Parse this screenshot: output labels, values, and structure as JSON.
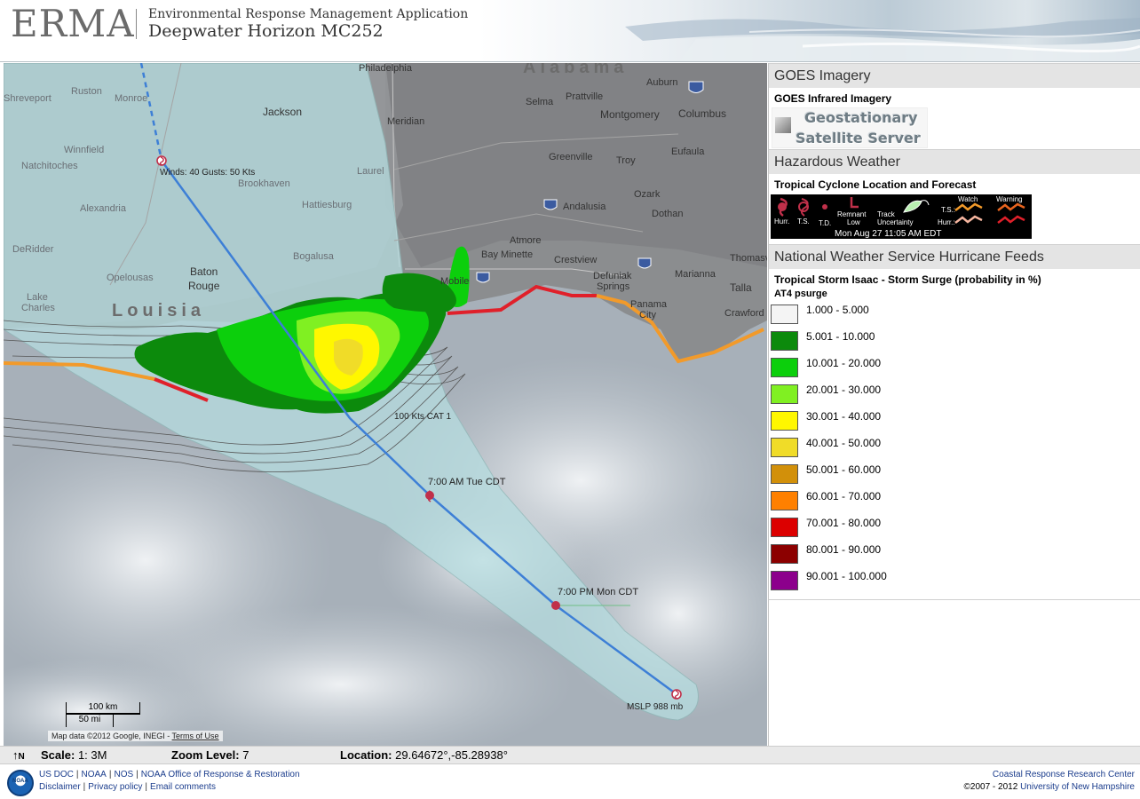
{
  "header": {
    "logo": "ERMA",
    "app_name": "Environmental Response Management Application",
    "app_subtitle": "Deepwater Horizon MC252"
  },
  "map": {
    "places": [
      {
        "name": "Shreveport"
      },
      {
        "name": "Ruston"
      },
      {
        "name": "Monroe"
      },
      {
        "name": "Jackson"
      },
      {
        "name": "Meridian"
      },
      {
        "name": "Philadelphia"
      },
      {
        "name": "Alabama"
      },
      {
        "name": "Selma"
      },
      {
        "name": "Prattville"
      },
      {
        "name": "Auburn"
      },
      {
        "name": "Montgomery"
      },
      {
        "name": "Columbus"
      },
      {
        "name": "Winnfield"
      },
      {
        "name": "Natchitoches"
      },
      {
        "name": "Greenville"
      },
      {
        "name": "Troy"
      },
      {
        "name": "Eufaula"
      },
      {
        "name": "Brookhaven"
      },
      {
        "name": "Laurel"
      },
      {
        "name": "Hattiesburg"
      },
      {
        "name": "Alexandria"
      },
      {
        "name": "Ozark"
      },
      {
        "name": "Andalusia"
      },
      {
        "name": "Dothan"
      },
      {
        "name": "DeRidder"
      },
      {
        "name": "Atmore"
      },
      {
        "name": "Bay Minette"
      },
      {
        "name": "Bogalusa"
      },
      {
        "name": "Crestview"
      },
      {
        "name": "Thomasv"
      },
      {
        "name": "Opelousas"
      },
      {
        "name": "Baton"
      },
      {
        "name": "Rouge"
      },
      {
        "name": "Mobile"
      },
      {
        "name": "Defuniak"
      },
      {
        "name": "Springs"
      },
      {
        "name": "Marianna"
      },
      {
        "name": "Talla"
      },
      {
        "name": "Lake"
      },
      {
        "name": "Charles"
      },
      {
        "name": "Louisia"
      },
      {
        "name": "Panama"
      },
      {
        "name": "City"
      },
      {
        "name": "Crawford"
      }
    ],
    "track_labels": [
      {
        "text": "Winds: 40 Gusts: 50 Kts"
      },
      {
        "text": "100 Kts CAT 1"
      },
      {
        "text": "7:00 AM Tue CDT"
      },
      {
        "text": "7:00 PM Mon CDT"
      },
      {
        "text": "MSLP 988 mb"
      }
    ],
    "scale": {
      "km": "100 km",
      "mi": "50 mi"
    },
    "attribution": "Map data ©2012 Google, INEGI - ",
    "terms_link": "Terms of Use"
  },
  "panel": {
    "goes": {
      "header": "GOES Imagery",
      "subtitle": "GOES Infrared Imagery",
      "logo_line1": "Geostationary",
      "logo_line2": "Satellite Server"
    },
    "hazard": {
      "header": "Hazardous Weather",
      "subtitle": "Tropical Cyclone Location and Forecast",
      "legend": {
        "hurr": "Hurr.",
        "ts": "T.S.",
        "td": "T.D.",
        "remnant": "Remnant",
        "low": "Low",
        "track": "Track",
        "uncertainty": "Uncertainty",
        "watch": "Watch",
        "warning": "Warning",
        "ts_row": "T.S.:",
        "hurr_row": "Hurr.:",
        "timestamp": "Mon Aug 27 11:05 AM EDT"
      }
    },
    "nws": {
      "header": "National Weather Service Hurricane Feeds",
      "surge_title": "Tropical Storm Isaac - Storm Surge (probability in %)",
      "layer_name": "AT4 psurge",
      "legend": [
        {
          "label": "1.000 - 5.000",
          "color": "#f4f4f4"
        },
        {
          "label": "5.001 - 10.000",
          "color": "#0c8a0c"
        },
        {
          "label": "10.001 - 20.000",
          "color": "#0ccf0c"
        },
        {
          "label": "20.001 - 30.000",
          "color": "#80f022"
        },
        {
          "label": "30.001 - 40.000",
          "color": "#fff700"
        },
        {
          "label": "40.001 - 50.000",
          "color": "#f0dc28"
        },
        {
          "label": "50.001 - 60.000",
          "color": "#d2900a"
        },
        {
          "label": "60.001 - 70.000",
          "color": "#ff8000"
        },
        {
          "label": "70.001 - 80.000",
          "color": "#dc0000"
        },
        {
          "label": "80.001 - 90.000",
          "color": "#8c0000"
        },
        {
          "label": "90.001 - 100.000",
          "color": "#8c008c"
        }
      ]
    }
  },
  "status": {
    "north": "N",
    "scale_label": "Scale:",
    "scale_value": "1: 3M",
    "zoom_label": "Zoom Level:",
    "zoom_value": "7",
    "location_label": "Location:",
    "location_value": "29.64672°,-85.28938°"
  },
  "footer": {
    "noaa": "NOAA",
    "links_row1": [
      "US DOC",
      "NOAA",
      "NOS",
      "NOAA Office of Response & Restoration"
    ],
    "links_row2": [
      "Disclaimer",
      "Privacy policy",
      "Email comments"
    ],
    "crrc": "Coastal Response Research Center",
    "copyright": "©2007 - 2012",
    "unh": "University of New Hampshire"
  },
  "colors": {
    "cone": "#b6dde0",
    "track": "#3d7fd6",
    "ts_watch": "#f29a2a",
    "hurr_warning": "#e0202a",
    "surge_dark": "#0c8a0c",
    "surge_light": "#0ccf0c"
  }
}
